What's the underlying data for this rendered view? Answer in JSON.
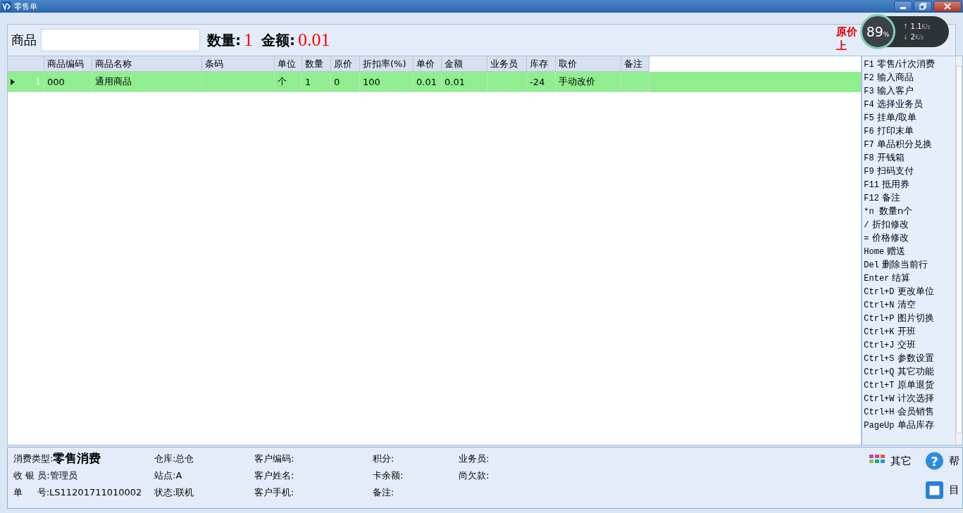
{
  "window": {
    "title": "零售单"
  },
  "entry": {
    "label": "商品",
    "qty_label": "数量:",
    "qty": "1",
    "amount_label": "金额:",
    "amount": "0.01"
  },
  "cut_labels": [
    "原价",
    "上"
  ],
  "monitor": {
    "percent": "89",
    "percent_unit": "%",
    "up_arrow": "↑",
    "up": "1.1",
    "up_unit": "K/s",
    "down_arrow": "↓",
    "down": "2",
    "down_unit": "K/s"
  },
  "table": {
    "columns": [
      "",
      "商品编码",
      "商品名称",
      "条码",
      "单位",
      "数量",
      "原价",
      "折扣率(%)",
      "单价",
      "金额",
      "业务员",
      "库存",
      "取价",
      "备注"
    ],
    "rows": [
      {
        "selected": true,
        "cells": [
          "1",
          "000",
          "通用商品",
          "",
          "个",
          "1",
          "0",
          "100",
          "0.01",
          "0.01",
          "",
          "-24",
          "手动改价",
          ""
        ]
      }
    ]
  },
  "shortcuts": [
    {
      "key": "F1",
      "label": "零售/计次消费"
    },
    {
      "key": "F2",
      "label": "输入商品"
    },
    {
      "key": "F3",
      "label": "输入客户"
    },
    {
      "key": "F4",
      "label": "选择业务员"
    },
    {
      "key": "F5",
      "label": "挂单/取单"
    },
    {
      "key": "F6",
      "label": "打印末单"
    },
    {
      "key": "F7",
      "label": "单品积分兑换"
    },
    {
      "key": "F8",
      "label": "开钱箱"
    },
    {
      "key": "F9",
      "label": "扫码支付"
    },
    {
      "key": "F11",
      "label": "抵用券"
    },
    {
      "key": "F12",
      "label": "备注"
    },
    {
      "key": "*n ",
      "label": "数量n个"
    },
    {
      "key": "/",
      "label": "折扣修改"
    },
    {
      "key": "=",
      "label": "价格修改"
    },
    {
      "key": "Home",
      "label": "赠送"
    },
    {
      "key": "Del",
      "label": "删除当前行"
    },
    {
      "key": "Enter",
      "label": "结算"
    },
    {
      "key": "Ctrl+D",
      "label": "更改单位"
    },
    {
      "key": "Ctrl+N",
      "label": "清空"
    },
    {
      "key": "Ctrl+P",
      "label": "图片切换"
    },
    {
      "key": "Ctrl+K",
      "label": "开班"
    },
    {
      "key": "Ctrl+J",
      "label": "交班"
    },
    {
      "key": "Ctrl+S",
      "label": "参数设置"
    },
    {
      "key": "Ctrl+Q",
      "label": "其它功能"
    },
    {
      "key": "Ctrl+T",
      "label": "原单退货"
    },
    {
      "key": "Ctrl+W",
      "label": "计次选择"
    },
    {
      "key": "Ctrl+H",
      "label": "会员销售"
    },
    {
      "key": "PageUp",
      "label": "单品库存"
    }
  ],
  "info": [
    [
      {
        "label": "消费类型:",
        "value": "零售消费",
        "bold": true
      },
      {
        "label": "仓库:",
        "value": "总仓"
      },
      {
        "label": "客户编码:"
      },
      {
        "label": "积分:"
      },
      {
        "label": "业务员:"
      }
    ],
    [
      {
        "label": "收 银 员:",
        "value": "管理员"
      },
      {
        "label": "站点:",
        "value": "A"
      },
      {
        "label": "客户姓名:"
      },
      {
        "label": "卡余额:"
      },
      {
        "label": "尚欠款:"
      }
    ],
    [
      {
        "label": "单     号:",
        "value": "LS11201711010002"
      },
      {
        "label": "状态:",
        "value": "联机"
      },
      {
        "label": "客户手机:"
      },
      {
        "label": "备注:"
      }
    ]
  ],
  "actions": [
    {
      "kind": "apps",
      "label": "其它"
    },
    {
      "kind": "help",
      "icon_text": "?",
      "label": "帮"
    },
    {
      "kind": "calendar",
      "label": "目"
    }
  ]
}
